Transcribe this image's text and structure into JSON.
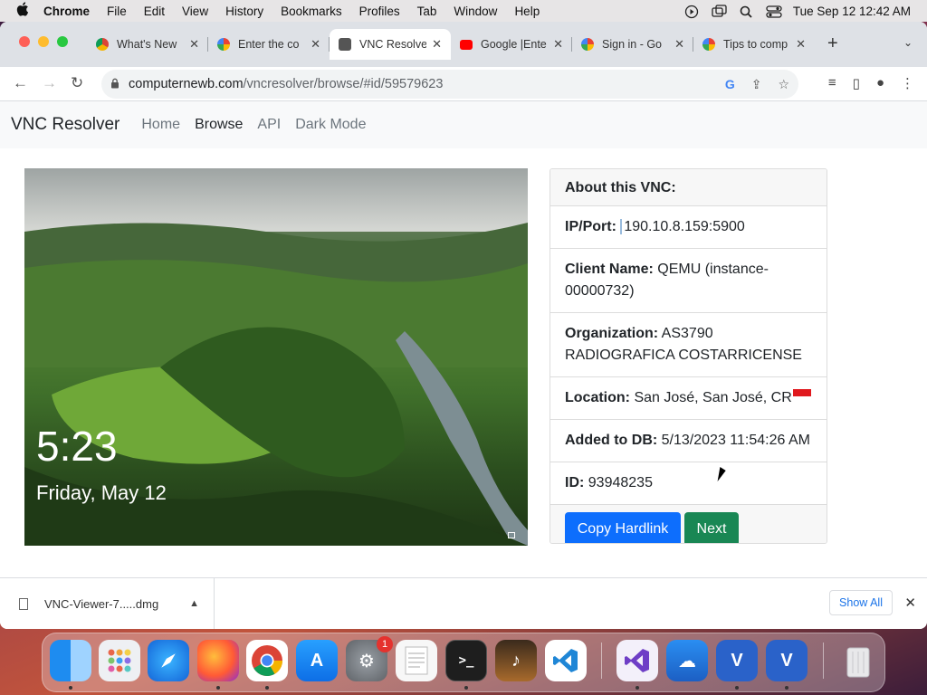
{
  "menubar": {
    "app": "Chrome",
    "items": [
      "File",
      "Edit",
      "View",
      "History",
      "Bookmarks",
      "Profiles",
      "Tab",
      "Window",
      "Help"
    ],
    "clock": "Tue Sep 12  12:42 AM"
  },
  "tabs": [
    {
      "title": "What's New",
      "color": "#5f6368"
    },
    {
      "title": "Enter the co",
      "color": "#4285f4"
    },
    {
      "title": "VNC Resolve",
      "color": "#444444",
      "active": true
    },
    {
      "title": "Google |Ente",
      "color": "#ff0000"
    },
    {
      "title": "Sign in - Go",
      "color": "#4285f4"
    },
    {
      "title": "Tips to comp",
      "color": "#4285f4"
    }
  ],
  "address": {
    "domain": "computernewb.com",
    "path": "/vncresolver/browse/#id/59579623"
  },
  "site": {
    "brand": "VNC Resolver",
    "nav": [
      "Home",
      "Browse",
      "API",
      "Dark Mode"
    ],
    "active_nav": "Browse"
  },
  "screenshot": {
    "time": "5:23",
    "date": "Friday, May 12"
  },
  "card": {
    "header": "About this VNC:",
    "ip_label": "IP/Port:",
    "ip_value": "190.10.8.159:5900",
    "client_label": "Client Name:",
    "client_value": "QEMU (instance-00000732)",
    "org_label": "Organization:",
    "org_value": "AS3790 RADIOGRAFICA COSTARRICENSE",
    "location_label": "Location:",
    "location_value": "San José, San José, CR",
    "added_label": "Added to DB:",
    "added_value": "5/13/2023 11:54:26 AM",
    "id_label": "ID:",
    "id_value": "93948235",
    "copy_button": "Copy Hardlink",
    "next_button": "Next"
  },
  "downloads": {
    "file": "VNC-Viewer-7.....dmg",
    "show_all": "Show All"
  },
  "dock": {
    "settings_badge": "1"
  }
}
